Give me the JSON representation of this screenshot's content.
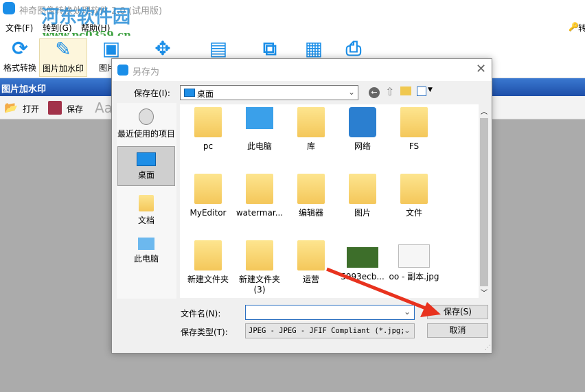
{
  "app": {
    "title": "神奇图像转换处理软件 2.0 (试用版)",
    "watermark": "河东软件园",
    "watermark_url": "www.pc0359.cn"
  },
  "menu": [
    "文件(F)",
    "转到(G)",
    "帮助(H)"
  ],
  "menu_right": "转",
  "toolbar": [
    {
      "label": "格式转换",
      "icon": "convert-icon"
    },
    {
      "label": "图片加水印",
      "icon": "brush-icon",
      "selected": true
    },
    {
      "label": "图片拼",
      "icon": "image-icon"
    },
    {
      "label": "",
      "icon": "move-icon"
    },
    {
      "label": "",
      "icon": "jpg-icon"
    },
    {
      "label": "",
      "icon": "ab-icon"
    },
    {
      "label": "",
      "icon": "grid-icon"
    },
    {
      "label": "",
      "icon": "printer-icon"
    }
  ],
  "section_title": "图片加水印",
  "subtoolbar": {
    "open": "打开",
    "save": "保存",
    "font": "Aa"
  },
  "dialog": {
    "title": "另存为",
    "save_in_label": "保存在(I):",
    "save_in_value": "桌面",
    "places": [
      "最近使用的项目",
      "桌面",
      "文档",
      "此电脑"
    ],
    "files": [
      {
        "name": "pc",
        "type": "user"
      },
      {
        "name": "此电脑",
        "type": "pc"
      },
      {
        "name": "库",
        "type": "library"
      },
      {
        "name": "网络",
        "type": "network"
      },
      {
        "name": "FS",
        "type": "folder"
      },
      {
        "name": "MyEditor",
        "type": "folder"
      },
      {
        "name": "watermar...",
        "type": "folder"
      },
      {
        "name": "编辑器",
        "type": "folder"
      },
      {
        "name": "图片",
        "type": "folder"
      },
      {
        "name": "文件",
        "type": "folder"
      },
      {
        "name": "新建文件夹",
        "type": "folder"
      },
      {
        "name": "新建文件夹 (3)",
        "type": "folder"
      },
      {
        "name": "运营",
        "type": "folder"
      },
      {
        "name": "5993ecb...",
        "type": "photo"
      },
      {
        "name": "oo - 副本.jpg",
        "type": "doc"
      }
    ],
    "filename_label": "文件名(N):",
    "filename_value": "",
    "filetype_label": "保存类型(T):",
    "filetype_value": "JPEG - JPEG - JFIF Compliant (*.jpg;*",
    "save_button": "保存(S)",
    "cancel_button": "取消"
  },
  "colors": {
    "accent": "#1a8ee8",
    "band": "#2a5fb8",
    "arrow": "#e8321e"
  }
}
